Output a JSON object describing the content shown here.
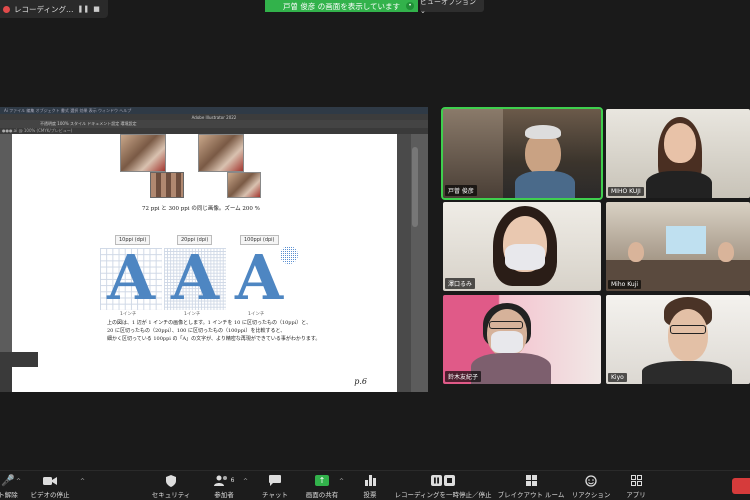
{
  "recording": {
    "label": "レコーディング…",
    "pause": "❚❚",
    "stop": "■"
  },
  "banner": {
    "text": "戸曽 俊彦 の画面を表示しています",
    "stop": "•"
  },
  "view_options": {
    "label": "ビューオプション ⌄"
  },
  "shared_app": {
    "menubar": "Ai  ファイル  編集  オブジェクト  書式  選択  効果  表示  ウィンドウ  ヘルプ",
    "title": "Adobe Illustrator 2022",
    "toolbar2": "不透明度  100%  スタイル  ドキュメント設定  環境設定",
    "tab": "●●●.ai @ 100% (CMYK/プレビュー)",
    "caption1": "72 ppi と 300 ppi の同じ画像。ズーム 200 %",
    "ppi_labels": [
      "10ppi (dpi)",
      "20ppi (dpi)",
      "100ppi (dpi)"
    ],
    "inch_labels": [
      "1インチ",
      "1インチ",
      "1インチ"
    ],
    "letter": "A",
    "body_lines": [
      "上の図は、1 辺が 1 インチの画像とします。1 インチを 10 に区切ったもの（10ppi）と、",
      "20 に区切ったもの（20ppi）、100 に区切ったもの（100ppi）を比較すると、",
      "細かく区切っている 100ppi の「A」の文字が、より精密な再現ができている事がわかります。"
    ],
    "page_number": "p.6"
  },
  "participants": [
    {
      "name": "戸曽 俊彦",
      "active": true
    },
    {
      "name": "MIHO KUJI",
      "active": false
    },
    {
      "name": "澤口るみ",
      "active": false
    },
    {
      "name": "Miho Kuji",
      "active": false
    },
    {
      "name": "鈴木友紀子",
      "active": false
    },
    {
      "name": "Kiyo",
      "active": false
    }
  ],
  "toolbar": {
    "unmute": "ト解除",
    "video": "ビデオの停止",
    "security": "セキュリティ",
    "participants": "参加者",
    "participants_count": "6",
    "chat": "チャット",
    "share": "画面の共有",
    "poll": "投票",
    "record": "レコーディングを一時停止／停止",
    "breakout": "ブレイクアウト ルーム",
    "reactions": "リアクション",
    "apps": "アプリ"
  },
  "colors": {
    "accent": "#32b24b",
    "active_outline": "#3fcf4e",
    "end": "#d63b3b",
    "letter_blue": "#4e86c2"
  }
}
